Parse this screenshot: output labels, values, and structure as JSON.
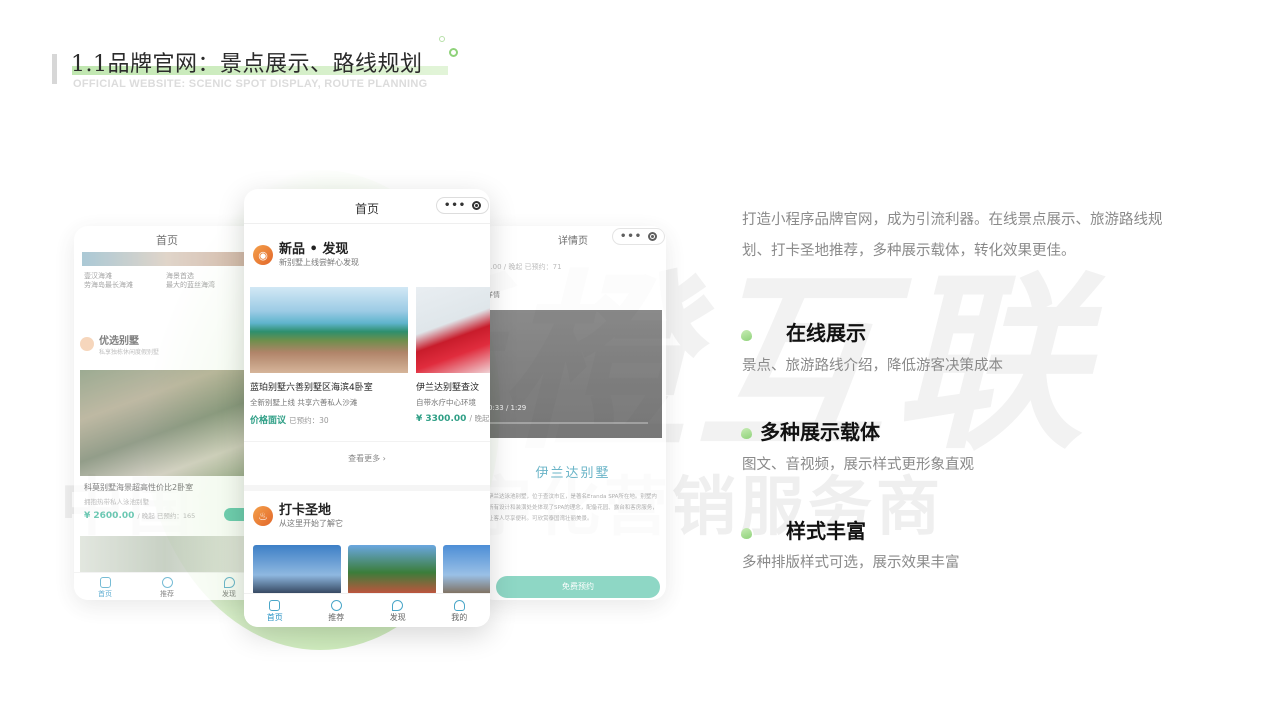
{
  "header": {
    "title": "1.1品牌官网：景点展示、路线规划",
    "subtitle": "OFFICIAL WEBSITE: SCENIC SPOT DISPLAY, ROUTE PLANNING"
  },
  "watermark": {
    "brand": "新橙互联",
    "slogan": "中国领先的数字化营销服务商"
  },
  "phone_left": {
    "title": "首页",
    "banner_captions": [
      "壹汉海滩\n劳海岛最长海滩",
      "海景首选\n最大的蓝丝海湾"
    ],
    "section_title": "优选别墅",
    "section_subtitle": "私享独栋休闲度假别墅",
    "card_name": "科莫别墅海景超高性价比2卧室",
    "card_desc": "拥抱热带私人泳池别墅",
    "card_price": "¥ 2600.00",
    "card_price_suffix": "/ 晚起  已预约：165",
    "tabs": [
      "首页",
      "推荐",
      "发现"
    ]
  },
  "phone_mid": {
    "title": "首页",
    "capsule_dots": "•••",
    "section1_title": "新品 • 发现",
    "section1_subtitle": "新别墅上线尝鲜心发现",
    "card1_name": "蓝珀别墅六善别墅区海滨4卧室",
    "card1_desc": "全新别墅上线 共享六善私人沙滩",
    "card1_price": "价格面议",
    "card1_price_suffix": "已预约：30",
    "card2_name": "伊兰达别墅查汶",
    "card2_desc": "自带水疗中心环境",
    "card2_price": "¥ 3300.00",
    "card2_price_suffix": "/ 晚起",
    "more_label": "查看更多 ›",
    "section2_title": "打卡圣地",
    "section2_subtitle": "从这里开始了解它",
    "tabs": [
      "首页",
      "推荐",
      "发现",
      "我的"
    ]
  },
  "phone_right": {
    "title": "详情页",
    "capsule_dots": "•••",
    "price_line": "3.00 / 晚起  已预约：71",
    "section_label": "详情",
    "video_time": "0:33 / 1:29",
    "logo_text": "伊兰达别墅",
    "paragraph": "伊兰达泳池别墅，位于查汶市区，是著名Eranda SPA所在地。别墅内所有设计和装潢处处体现了SPA的理念，配备花园、露台和客房服务，让客人尽享便利。可欣赏泰国湾壮丽美景。",
    "button_label": "免费预约"
  },
  "intro": "打造小程序品牌官网，成为引流利器。在线景点展示、旅游路线规划、打卡圣地推荐，多种展示载体，转化效果更佳。",
  "features": [
    {
      "title": "在线展示",
      "desc": "景点、旅游路线介绍，降低游客决策成本"
    },
    {
      "title": "多种展示载体",
      "desc": "图文、音视频，展示样式更形象直观"
    },
    {
      "title": "样式丰富",
      "desc": "多种排版样式可选，展示效果丰富"
    }
  ],
  "colors": {
    "accent_green": "#8fd27a",
    "price_teal": "#2f9f86",
    "section_orange": "#e2662a",
    "button_teal": "#6fcdb5"
  }
}
